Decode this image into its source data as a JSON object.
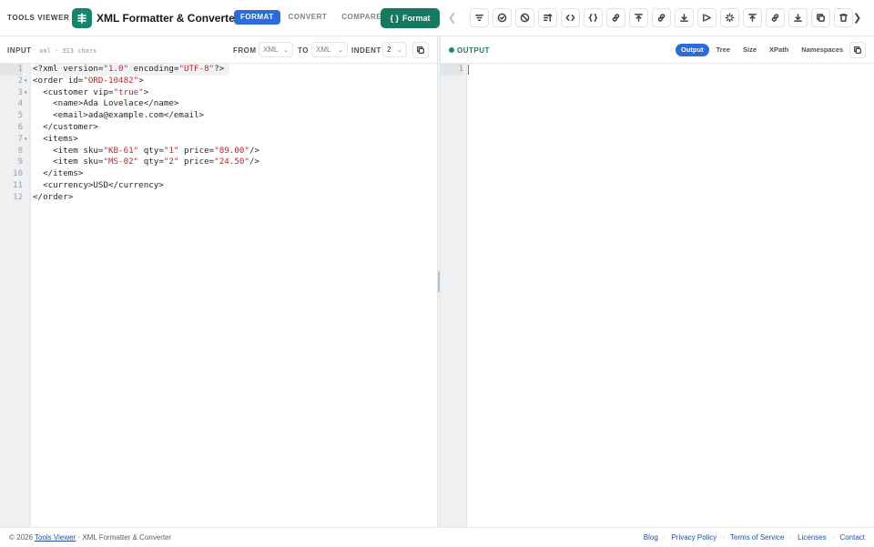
{
  "header": {
    "brand": "TOOLS VIEWER",
    "app_title": "XML Formatter & Converter",
    "modes": [
      {
        "label": "FORMAT",
        "active": true
      },
      {
        "label": "CONVERT",
        "active": false
      },
      {
        "label": "COMPARE",
        "active": false
      }
    ],
    "format_button": "Format",
    "format_icon": "{ }",
    "toolbar_icons": [
      "filter-icon",
      "check-circle-icon",
      "ban-icon",
      "sort-icon",
      "code-bracket-icon",
      "braces-icon",
      "link-icon",
      "upload-icon",
      "link-icon",
      "download-icon",
      "send-icon",
      "sparkle-icon",
      "upload-icon",
      "link-icon",
      "download-icon",
      "copy-icon",
      "trash-icon"
    ]
  },
  "input_panel": {
    "label": "INPUT",
    "meta": "xml · 313 chars",
    "from_label": "FROM",
    "from_value": "XML",
    "to_label": "TO",
    "to_value": "XML",
    "indent_label": "INDENT",
    "indent_value": "2",
    "line_numbers": [
      "1",
      "2",
      "3",
      "4",
      "5",
      "6",
      "7",
      "8",
      "9",
      "10",
      "11",
      "12"
    ],
    "fold_lines": [
      2,
      3,
      7
    ],
    "code_lines": [
      [
        {
          "t": "<?xml version="
        },
        {
          "t": "\"1.0\"",
          "c": "str"
        },
        {
          "t": " encoding="
        },
        {
          "t": "\"UTF-8\"",
          "c": "str"
        },
        {
          "t": "?>"
        }
      ],
      [
        {
          "t": "<order id="
        },
        {
          "t": "\"ORD-10482\"",
          "c": "str"
        },
        {
          "t": ">"
        }
      ],
      [
        {
          "t": "  <customer vip="
        },
        {
          "t": "\"true\"",
          "c": "str"
        },
        {
          "t": ">"
        }
      ],
      [
        {
          "t": "    <name>Ada Lovelace</name>"
        }
      ],
      [
        {
          "t": "    <email>ada@example.com</email>"
        }
      ],
      [
        {
          "t": "  </customer>"
        }
      ],
      [
        {
          "t": "  <items>"
        }
      ],
      [
        {
          "t": "    <item sku="
        },
        {
          "t": "\"KB-61\"",
          "c": "str"
        },
        {
          "t": " qty="
        },
        {
          "t": "\"1\"",
          "c": "str"
        },
        {
          "t": " price="
        },
        {
          "t": "\"89.00\"",
          "c": "str"
        },
        {
          "t": "/>"
        }
      ],
      [
        {
          "t": "    <item sku="
        },
        {
          "t": "\"MS-02\"",
          "c": "str"
        },
        {
          "t": " qty="
        },
        {
          "t": "\"2\"",
          "c": "str"
        },
        {
          "t": " price="
        },
        {
          "t": "\"24.50\"",
          "c": "str"
        },
        {
          "t": "/>"
        }
      ],
      [
        {
          "t": "  </items>"
        }
      ],
      [
        {
          "t": "  <currency>USD</currency>"
        }
      ],
      [
        {
          "t": "</order>"
        }
      ]
    ]
  },
  "output_panel": {
    "label": "OUTPUT",
    "view_tabs": [
      {
        "label": "Output",
        "active": true
      },
      {
        "label": "Tree",
        "active": false
      },
      {
        "label": "Size",
        "active": false
      },
      {
        "label": "XPath",
        "active": false
      },
      {
        "label": "Namespaces",
        "active": false
      }
    ],
    "line_numbers": [
      "1"
    ]
  },
  "footer": {
    "copyright": "© 2026",
    "site_link": "Tools Viewer",
    "suffix": "· XML Formatter & Converter",
    "links": [
      "Blog",
      "Privacy Policy",
      "Terms of Service",
      "Licenses",
      "Contact"
    ]
  },
  "colors": {
    "accent_blue": "#2b6bdb",
    "brand_green": "#15795f",
    "string_red": "#c0262d"
  }
}
